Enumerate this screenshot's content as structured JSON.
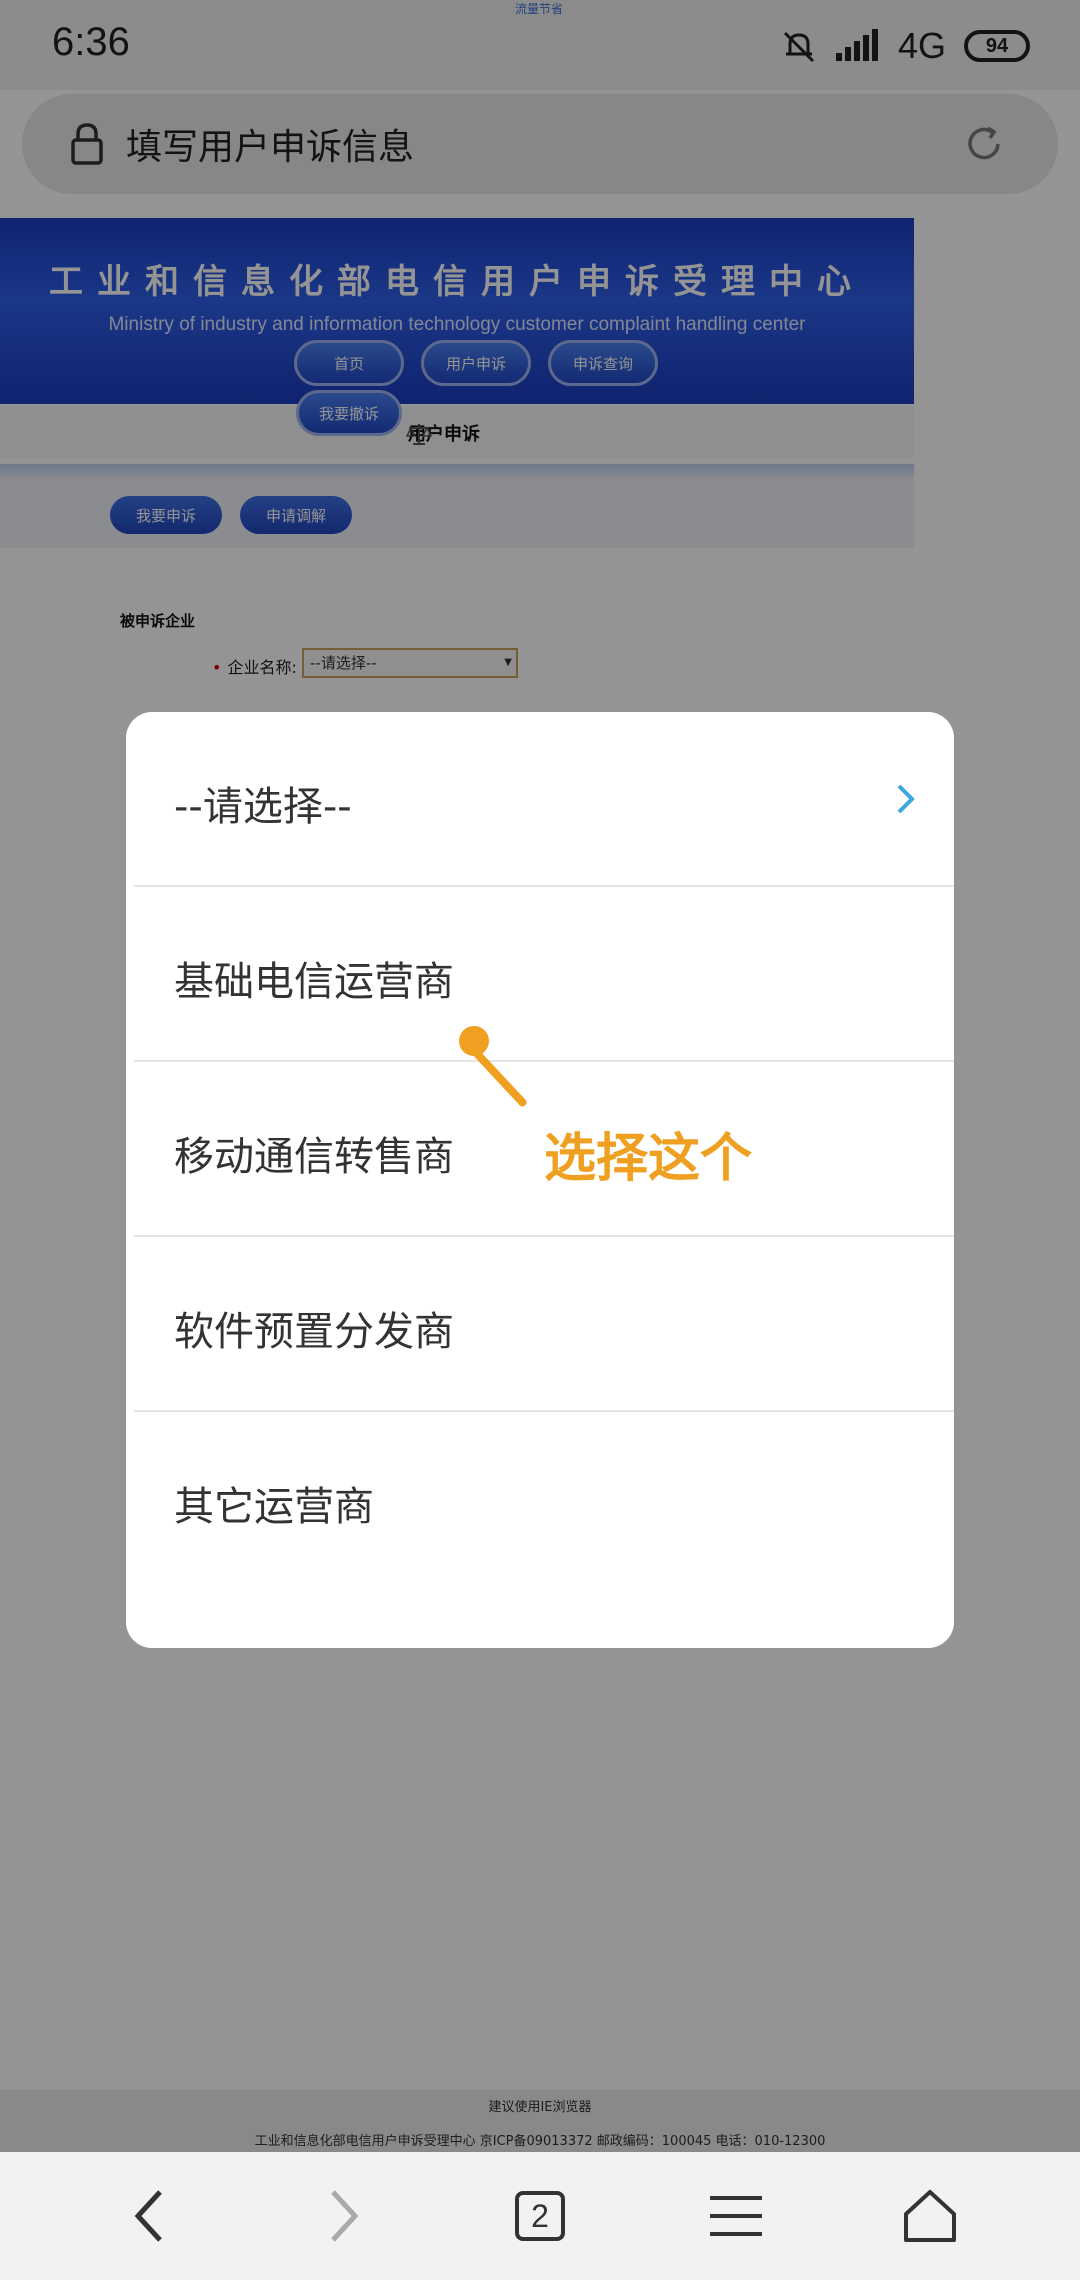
{
  "status_bar": {
    "time": "6:36",
    "network": "4G",
    "battery": "94",
    "tiny_notice": "流量节省"
  },
  "address_bar": {
    "title": "填写用户申诉信息"
  },
  "banner": {
    "title": "工业和信息化部电信用户申诉受理中心",
    "subtitle": "Ministry of industry and information technology customer complaint handling center",
    "nav": [
      "首页",
      "用户申诉",
      "申诉查询",
      "我要撤诉"
    ]
  },
  "subheader": {
    "label": "用户申诉"
  },
  "actions": [
    "我要申诉",
    "申请调解"
  ],
  "form": {
    "section": "被申诉企业",
    "field_label": "企业名称:",
    "select_value": "--请选择--"
  },
  "modal": {
    "options": [
      "--请选择--",
      "基础电信运营商",
      "移动通信转售商",
      "软件预置分发商",
      "其它运营商"
    ]
  },
  "annotation": {
    "text": "选择这个"
  },
  "footer": {
    "line1": "建议使用IE浏览器",
    "line2": "工业和信息化部电信用户申诉受理中心 京ICP备09013372 邮政编码：100045 电话：010-12300"
  },
  "bottom_nav": {
    "tabs_count": "2"
  },
  "colors": {
    "accent_orange": "#f0a020",
    "chevron_blue": "#3aa8e0",
    "banner_blue": "#1a3fc4"
  }
}
